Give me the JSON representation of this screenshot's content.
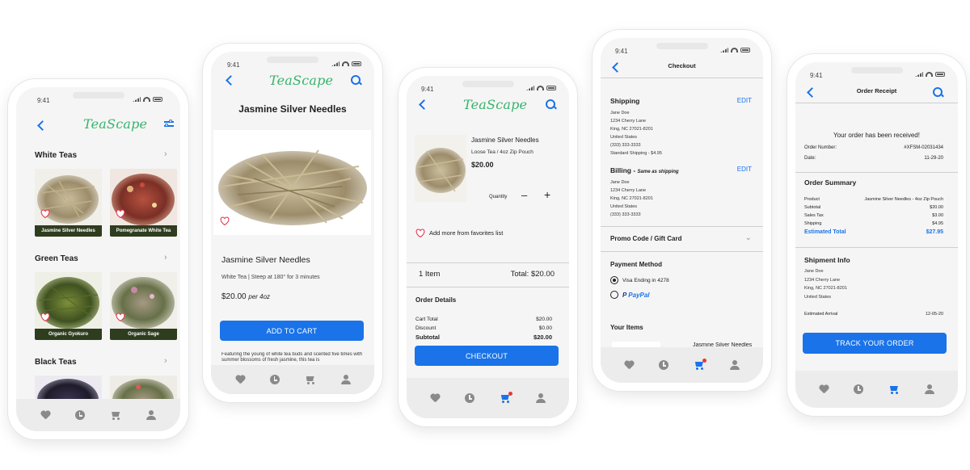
{
  "status": {
    "time": "9:41"
  },
  "brand": {
    "logo": "TeaScape",
    "accent": "#1a73e8",
    "logo_color": "#37b36b"
  },
  "screen1": {
    "sections": [
      {
        "title": "White Teas",
        "items": [
          "Jasmine Silver Needles",
          "Pomegranate White Tea"
        ]
      },
      {
        "title": "Green Teas",
        "items": [
          "Organic Gyokuro",
          "Organic Sage"
        ]
      },
      {
        "title": "Black Teas",
        "items": [
          "",
          ""
        ]
      }
    ]
  },
  "screen2": {
    "header_title": "Jasmine Silver Needles",
    "product_name": "Jasmine Silver Needles",
    "subtitle": "White Tea | Steep at 180° for 3 minutes",
    "price": "$20.00",
    "price_unit": "per 4oz",
    "add_to_cart": "ADD TO CART",
    "description": "Featuring the young of white tea buds and scented five times with summer blossoms of fresh jasmine, this tea is"
  },
  "screen3": {
    "item_name": "Jasmine Silver Needles",
    "item_variant": "Loose Tea / 4oz Zip Pouch",
    "item_price": "$20.00",
    "quantity_label": "Quantity",
    "add_favorites": "Add more from favorites list",
    "item_count": "1 Item",
    "total": "Total: $20.00",
    "order_details_title": "Order Details",
    "rows": [
      {
        "label": "Cart Total",
        "value": "$20.00"
      },
      {
        "label": "Discount",
        "value": "$0.00"
      },
      {
        "label": "Subtotal",
        "value": "$20.00"
      }
    ],
    "checkout": "CHECKOUT"
  },
  "screen4": {
    "title": "Checkout",
    "shipping_title": "Shipping",
    "edit": "EDIT",
    "shipping_lines": [
      "Jane Doe",
      "1234 Cherry Lane",
      "King, NC 27021-8201",
      "United States",
      "(333) 333-3333",
      "Standard Shipping - $4.95"
    ],
    "billing_title": "Billing -",
    "billing_note": "Same as shipping",
    "billing_lines": [
      "Jane Doe",
      "1234 Cherry Lane",
      "King, NC 27021-8201",
      "United States",
      "(333) 333-3333"
    ],
    "promo": "Promo Code / Gift Card",
    "payment_title": "Payment Method",
    "visa": "Visa Ending in 4278",
    "paypal": "PayPal",
    "your_items": "Your Items",
    "items_preview": "Jasmine Silver Needles"
  },
  "screen5": {
    "title": "Order Receipt",
    "received": "Your order has been received!",
    "order_number_label": "Order Number:",
    "order_number": "#XFSM-02031434",
    "date_label": "Date:",
    "date": "11-29-20",
    "summary_title": "Order Summary",
    "summary_rows": [
      {
        "label": "Product",
        "value": "Jasmine Silver Needles - 4oz Zip Pouch"
      },
      {
        "label": "Subtotal",
        "value": "$20.00"
      },
      {
        "label": "Sales Tax",
        "value": "$3.00"
      },
      {
        "label": "Shipping",
        "value": "$4.95"
      }
    ],
    "est_total_label": "Estimated Total",
    "est_total": "$27.95",
    "shipment_title": "Shipment Info",
    "shipment_lines": [
      "Jane Doe",
      "1234 Cherry Lane",
      "King, NC 27021-8201",
      "United States"
    ],
    "arrival_label": "Estimated Arrival",
    "arrival": "12-05-20",
    "track": "TRACK YOUR ORDER"
  }
}
